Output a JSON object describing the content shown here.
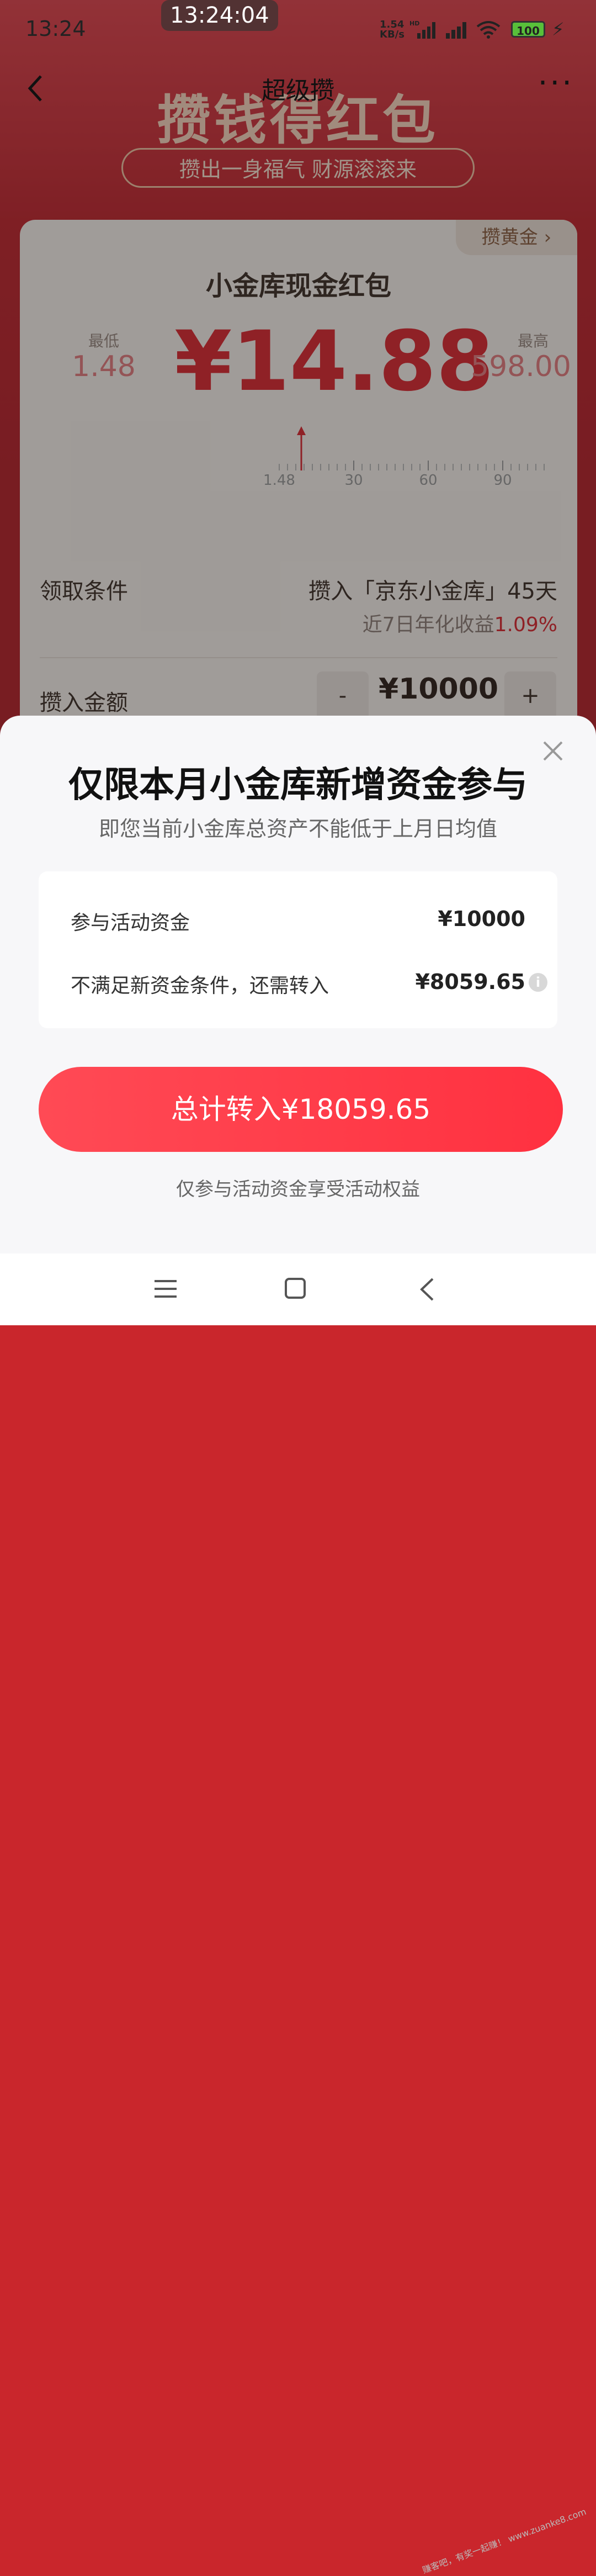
{
  "status_bar": {
    "time": "13:24",
    "clock_overlay": "13:24:04",
    "net_speed_line1": "1.54",
    "net_speed_line2": "KB/s",
    "battery": "100"
  },
  "nav": {
    "title": "超级攒",
    "back_icon": "chevron-left-icon",
    "more_icon": "more-horizontal-icon"
  },
  "banner": {
    "title": "攒钱得红包",
    "slogan": "攒出一身福气 财源滚滚来"
  },
  "card": {
    "gold_tab": "攒黄金 ›",
    "title": "小金库现金红包",
    "min_label": "最低",
    "min_value": "1.48",
    "max_label": "最高",
    "max_value": "598.00",
    "amount": "¥14.88",
    "scale_labels": [
      "1.48",
      "30",
      "60",
      "90"
    ],
    "condition_label": "领取条件",
    "condition_value": "攒入「京东小金库」45天",
    "rate_prefix": "近7日年化收益",
    "rate_value": "1.09%",
    "deposit_label": "攒入金额",
    "minus": "-",
    "deposit_value": "¥10000",
    "plus": "+"
  },
  "sheet": {
    "title": "仅限本月小金库新增资金参与",
    "subtitle": "即您当前小金库总资产不能低于上月日均值",
    "rows": [
      {
        "label": "参与活动资金",
        "value": "¥10000"
      },
      {
        "label": "不满足新资金条件，还需转入",
        "value": "¥8059.65"
      }
    ],
    "info_icon": "i",
    "cta_label": "总计转入¥18059.65",
    "footnote": "仅参与活动资金享受活动权益"
  },
  "watermark": "赚客吧，有奖一起赚！ www.zuanke8.com",
  "colors": {
    "brand_red": "#e0242c",
    "cta_red": "#ff3140",
    "sheet_bg": "#f7f7f9"
  }
}
